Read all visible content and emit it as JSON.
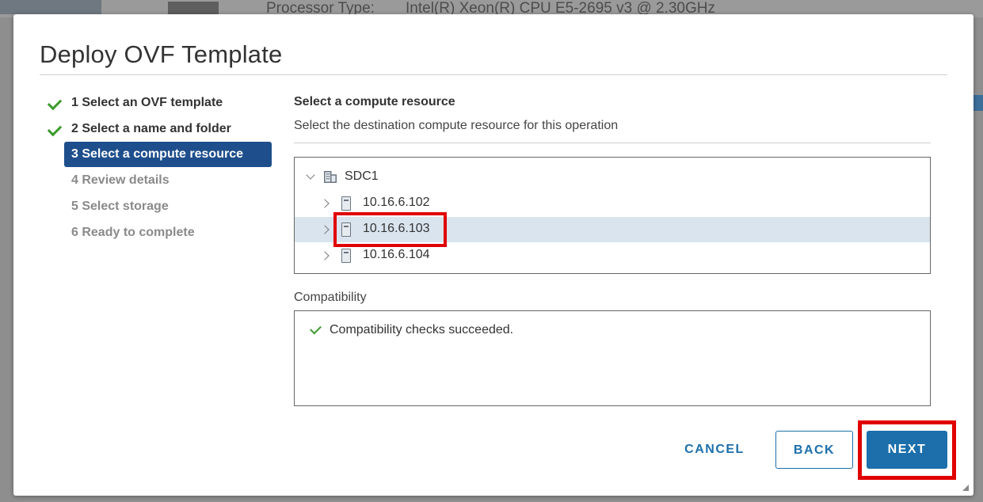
{
  "background": {
    "processor_label": "Processor Type:",
    "processor_value": "Intel(R) Xeon(R) CPU E5-2695 v3 @ 2.30GHz"
  },
  "dialog": {
    "title": "Deploy OVF Template"
  },
  "steps": [
    {
      "label": "1 Select an OVF template",
      "state": "done"
    },
    {
      "label": "2 Select a name and folder",
      "state": "done"
    },
    {
      "label": "3 Select a compute resource",
      "state": "active"
    },
    {
      "label": "4 Review details",
      "state": "disabled"
    },
    {
      "label": "5 Select storage",
      "state": "disabled"
    },
    {
      "label": "6 Ready to complete",
      "state": "disabled"
    }
  ],
  "content": {
    "heading": "Select a compute resource",
    "subheading": "Select the destination compute resource for this operation"
  },
  "tree": {
    "root": {
      "label": "SDC1",
      "icon": "datacenter-icon",
      "expanded": true
    },
    "hosts": [
      {
        "label": "10.16.6.102",
        "icon": "host-icon",
        "selected": false
      },
      {
        "label": "10.16.6.103",
        "icon": "host-icon",
        "selected": true
      },
      {
        "label": "10.16.6.104",
        "icon": "host-icon",
        "selected": false
      }
    ]
  },
  "compatibility": {
    "label": "Compatibility",
    "message": "Compatibility checks succeeded."
  },
  "buttons": {
    "cancel": "CANCEL",
    "back": "BACK",
    "next": "NEXT"
  },
  "colors": {
    "accent": "#1c6fab",
    "active_step": "#1e4e8c",
    "highlight": "#e00000",
    "success": "#3c9a2c",
    "selection": "#d9e4ee"
  }
}
